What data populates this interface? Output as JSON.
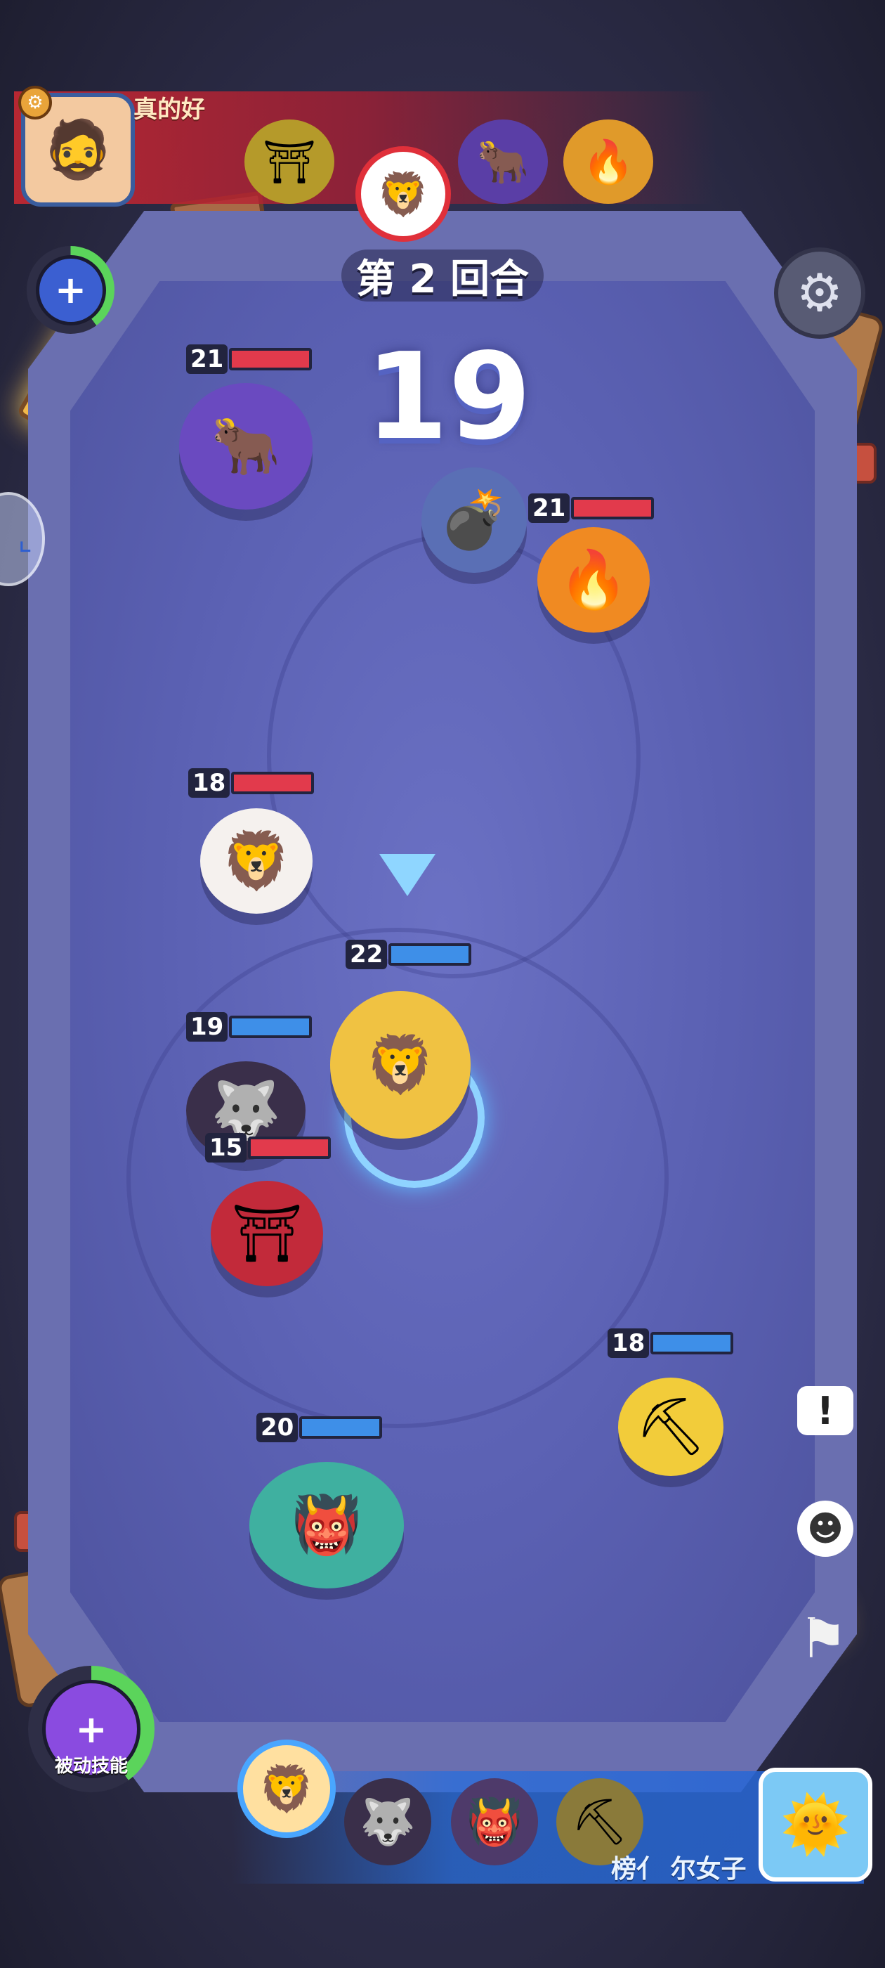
{
  "header": {
    "player_name": "真的好",
    "round_label": "第 2 回合",
    "timer": "19"
  },
  "colors": {
    "enemy_hp": "#e23a4c",
    "ally_hp": "#3e8fe8",
    "enemy_banner": "#c8283a",
    "ally_banner": "#2b6ed8"
  },
  "enemy_lineup": [
    {
      "icon": "samurai-enemy-icon"
    },
    {
      "icon": "white-lion-enemy-icon",
      "active": true
    },
    {
      "icon": "purple-ox-enemy-icon"
    },
    {
      "icon": "fire-spirit-enemy-icon"
    }
  ],
  "units": [
    {
      "side": "enemy",
      "hp": "21",
      "name": "purple-ox"
    },
    {
      "side": "enemy",
      "hp": "21",
      "name": "fire-spirit"
    },
    {
      "side": "enemy",
      "hp": "18",
      "name": "white-lion"
    },
    {
      "side": "enemy",
      "hp": "15",
      "name": "samurai"
    },
    {
      "side": "ally",
      "hp": "22",
      "name": "golden-warrior"
    },
    {
      "side": "ally",
      "hp": "19",
      "name": "dark-wolf"
    },
    {
      "side": "ally",
      "hp": "18",
      "name": "miner"
    },
    {
      "side": "ally",
      "hp": "20",
      "name": "green-ogre"
    }
  ],
  "bottom": {
    "passive_skill_label": "被动技能",
    "opponent_name": "榜亻 尔女子"
  },
  "queue": [
    {
      "icon": "golden-warrior-queue-icon",
      "active": true
    },
    {
      "icon": "dark-wolf-queue-icon"
    },
    {
      "icon": "green-ogre-queue-icon"
    },
    {
      "icon": "miner-queue-icon"
    }
  ]
}
